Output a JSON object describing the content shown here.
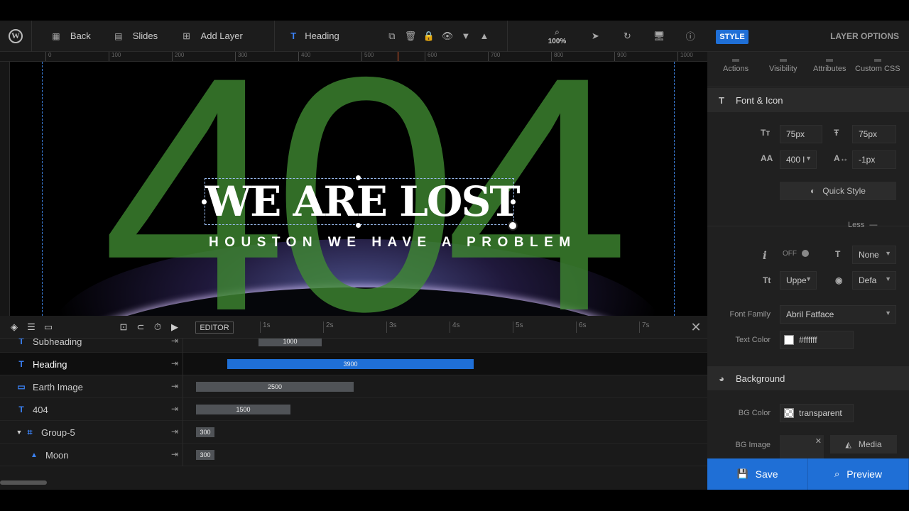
{
  "toolbar": {
    "back_label": "Back",
    "slides_label": "Slides",
    "add_layer_label": "Add Layer",
    "selected_layer": "Heading",
    "zoom": "100%"
  },
  "ruler": {
    "ticks": [
      "0",
      "100",
      "200",
      "300",
      "400",
      "500",
      "600",
      "700",
      "800",
      "900",
      "1000"
    ]
  },
  "canvas": {
    "bg_text": "404",
    "heading": "WE ARE LOST",
    "subheading": "HOUSTON WE HAVE A PROBLEM"
  },
  "timeline": {
    "editor_label": "EDITOR",
    "seconds": [
      "1s",
      "2s",
      "3s",
      "4s",
      "5s",
      "6s",
      "7s"
    ],
    "rows": [
      {
        "label": "Subheading",
        "icon": "text-icon",
        "duration": "1000"
      },
      {
        "label": "Heading",
        "icon": "text-icon",
        "duration": "3900"
      },
      {
        "label": "Earth Image",
        "icon": "image-icon",
        "duration": "2500"
      },
      {
        "label": "404",
        "icon": "text-icon",
        "duration": "1500"
      },
      {
        "label": "Group-5",
        "icon": "group-icon",
        "duration": "300"
      },
      {
        "label": "Moon",
        "icon": "shape-icon",
        "duration": "300"
      }
    ]
  },
  "panel": {
    "style_tab": "STYLE",
    "layer_options": "LAYER OPTIONS",
    "subtabs": [
      "Actions",
      "Visibility",
      "Attributes",
      "Custom CSS"
    ],
    "font_icon_title": "Font & Icon",
    "font_size": "75px",
    "line_height": "75px",
    "font_weight": "400 l",
    "letter_spacing": "-1px",
    "quick_style": "Quick Style",
    "less_label": "Less",
    "italic_toggle": "OFF",
    "text_decoration": "None",
    "text_transform": "Uppe",
    "cursor": "Defa",
    "font_family_label": "Font Family",
    "font_family_value": "Abril Fatface",
    "text_color_label": "Text Color",
    "text_color_value": "#ffffff",
    "background_title": "Background",
    "bg_color_label": "BG Color",
    "bg_color_value": "transparent",
    "bg_image_label": "BG Image",
    "media_label": "Media",
    "save_label": "Save",
    "preview_label": "Preview"
  }
}
